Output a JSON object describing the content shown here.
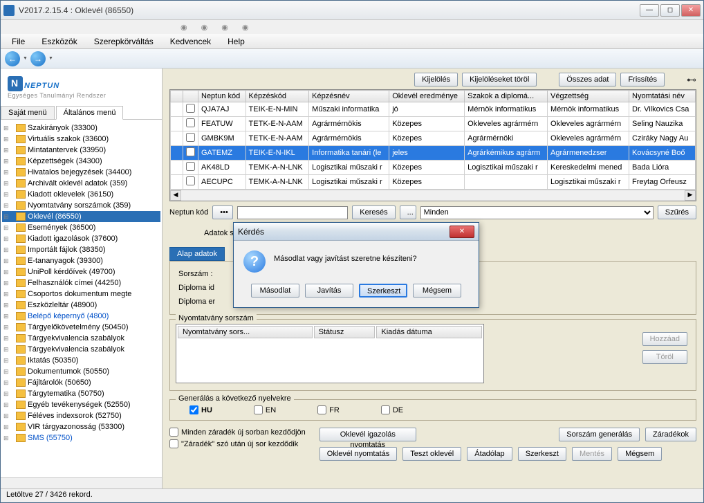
{
  "title": "V2017.2.15.4 : Oklevél (86550)",
  "menu": {
    "file": "File",
    "tools": "Eszközök",
    "roles": "Szerepkörváltás",
    "fav": "Kedvencek",
    "help": "Help"
  },
  "logo": {
    "text": "NEPTUN",
    "sub": "Egységes Tanulmányi Rendszer"
  },
  "side_tabs": {
    "own": "Saját menü",
    "general": "Általános menü"
  },
  "tree": [
    {
      "label": "Szakirányok (33300)"
    },
    {
      "label": "Virtuális szakok (33600)"
    },
    {
      "label": "Mintatantervek (33950)"
    },
    {
      "label": "Képzettségek (34300)"
    },
    {
      "label": "Hivatalos bejegyzések (34400)"
    },
    {
      "label": "Archivált oklevél adatok (359)"
    },
    {
      "label": "Kiadott oklevelek (36150)"
    },
    {
      "label": "Nyomtatvány sorszámok (359)"
    },
    {
      "label": "Oklevél (86550)",
      "selected": true
    },
    {
      "label": "Események (36500)"
    },
    {
      "label": "Kiadott igazolások (37600)"
    },
    {
      "label": "Importált fájlok (38350)"
    },
    {
      "label": "E-tananyagok (39300)"
    },
    {
      "label": "UniPoll kérdőívek (49700)"
    },
    {
      "label": "Felhasználók címei (44250)"
    },
    {
      "label": "Csoportos dokumentum megte"
    },
    {
      "label": "Eszközleltár (48900)"
    },
    {
      "label": "Belépő képernyő (4800)",
      "link": true
    },
    {
      "label": "Tárgyelőkövetelmény (50450)"
    },
    {
      "label": "Tárgyekvivalencia szabályok"
    },
    {
      "label": "Tárgyekvivalencia szabályok"
    },
    {
      "label": "Iktatás (50350)"
    },
    {
      "label": "Dokumentumok (50550)"
    },
    {
      "label": "Fájltárolók (50650)"
    },
    {
      "label": "Tárgytematika (50750)"
    },
    {
      "label": "Egyéb tevékenységek (52550)"
    },
    {
      "label": "Féléves indexsorok (52750)"
    },
    {
      "label": "VIR tárgyazonosság (53300)"
    },
    {
      "label": "SMS (55750)",
      "link": true
    }
  ],
  "top_buttons": {
    "select": "Kijelölés",
    "clear": "Kijelöléseket töröl",
    "all": "Összes adat",
    "refresh": "Frissítés"
  },
  "grid": {
    "cols": [
      "Neptun kód",
      "Képzéskód",
      "Képzésnév",
      "Oklevél eredménye",
      "Szakok a diplomá...",
      "Végzettség",
      "Nyomtatási név"
    ],
    "rows": [
      [
        "QJA7AJ",
        "TEIK-E-N-MIN",
        "Műszaki informatika",
        "jó",
        "Mérnök informatikus",
        "Mérnök informatikus",
        "Dr. Vilkovics Csa"
      ],
      [
        "FEATUW",
        "TETK-E-N-AAM",
        "Agrármérnökis",
        "Közepes",
        "Okleveles agrármérn",
        "Okleveles agrármérn",
        "Seling Nauzika"
      ],
      [
        "GMBK9M",
        "TETK-E-N-AAM",
        "Agrármérnökis",
        "Közepes",
        "Agrármérnöki",
        "Okleveles agrármérn",
        "Cziráky Nagy Au"
      ],
      [
        "GATEMZ",
        "TEIK-E-N-IKL",
        "Informatika tanári (le",
        "jeles",
        "Agrárkémikus agrárm",
        "Agrármenedzser",
        "Kovácsyné Boő"
      ],
      [
        "AK48LD",
        "TEMK-A-N-LNK",
        "Logisztikai műszaki r",
        "Közepes",
        "Logisztikai műszaki r",
        "Kereskedelmi mened",
        "Bada Lióra"
      ],
      [
        "AECUPC",
        "TEMK-A-N-LNK",
        "Logisztikai műszaki r",
        "Közepes",
        "",
        "Logisztikai műszaki r",
        "Freytag Orfeusz"
      ]
    ],
    "selected_row": 3
  },
  "search": {
    "label": "Neptun kód",
    "btn": "Keresés",
    "dots": "...",
    "filter_val": "Minden",
    "filter_btn": "Szűrés"
  },
  "mid": {
    "label": "Adatok szakos oklevélhez",
    "arrow": "->"
  },
  "main_tab": "Alap adatok",
  "form": {
    "sorszam": "Sorszám :",
    "dip_id": "Diploma id",
    "dip_er": "Diploma er"
  },
  "group_ny": {
    "title": "Nyomtatvány sorszám",
    "c1": "Nyomtatvány sors...",
    "c2": "Státusz",
    "c3": "Kiadás dátuma",
    "add": "Hozzáad",
    "del": "Töröl"
  },
  "lang": {
    "title": "Generálás a következő nyelvekre",
    "hu": "HU",
    "en": "EN",
    "fr": "FR",
    "de": "DE"
  },
  "checks": {
    "c1": "Minden záradék új sorban kezdődjön",
    "c2": "\"Záradék\" szó után új sor kezdődik"
  },
  "bottom": {
    "okig": "Oklevél igazolás nyomtatás",
    "sorgen": "Sorszám generálás",
    "zar": "Záradékok",
    "okny": "Oklevél nyomtatás",
    "teszt": "Teszt oklevél",
    "atad": "Átadólap",
    "szerk": "Szerkeszt",
    "mentes": "Mentés",
    "megsem": "Mégsem"
  },
  "status": "Letöltve 27 / 3426 rekord.",
  "dialog": {
    "title": "Kérdés",
    "msg": "Másodlat vagy javítást szeretne készíteni?",
    "b1": "Másodlat",
    "b2": "Javítás",
    "b3": "Szerkeszt",
    "b4": "Mégsem"
  }
}
